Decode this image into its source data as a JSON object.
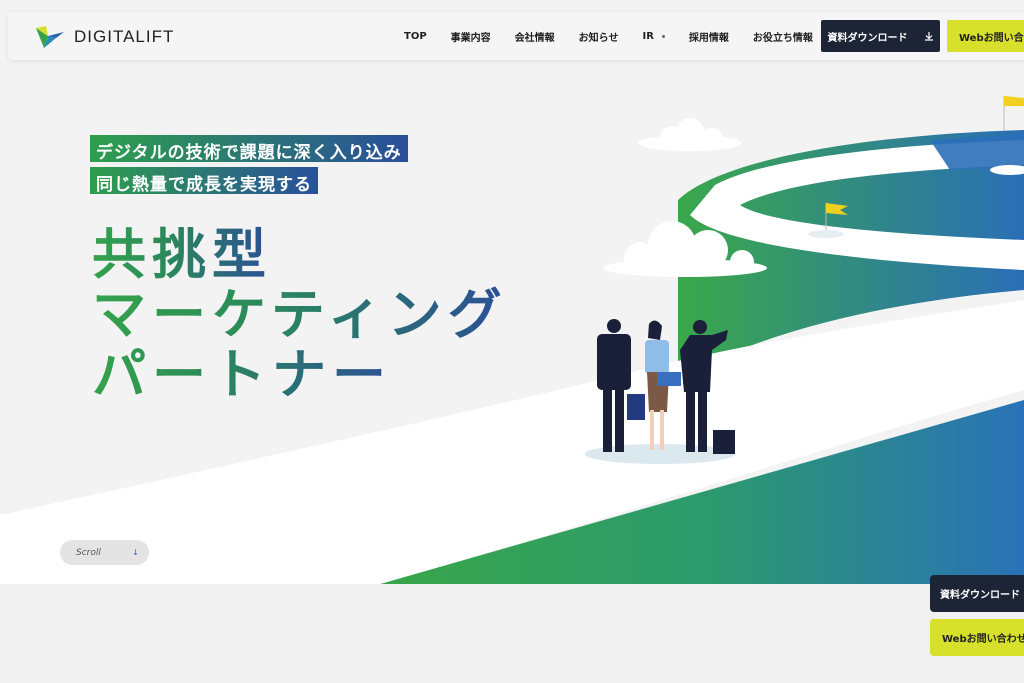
{
  "header": {
    "logo_text": "DIGITALIFT",
    "nav": [
      "TOP",
      "事業内容",
      "会社情報",
      "お知らせ",
      "IR",
      "採用情報",
      "お役立ち情報"
    ],
    "download_label": "資料ダウンロード",
    "contact_label": "Webお問い合わせ"
  },
  "hero": {
    "tagline_1": "デジタルの技術で課題に深く入り込み",
    "tagline_2": "同じ熱量で成長を実現する",
    "headline_1": "共挑型",
    "headline_2": "マーケティング",
    "headline_3": "パートナー",
    "scroll_label": "Scroll"
  },
  "floating": {
    "download_label": "資料ダウンロード",
    "contact_label": "Webお問い合わせ"
  },
  "colors": {
    "navy": "#1c2436",
    "lime": "#d7e02a",
    "green": "#35a24b",
    "blue": "#2a5fb0"
  }
}
